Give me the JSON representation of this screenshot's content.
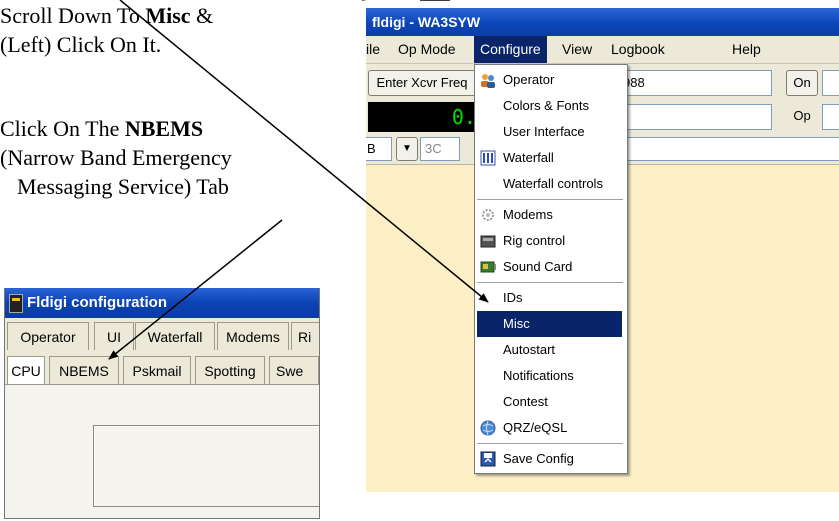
{
  "instructions": {
    "step1_line1_pre": "Scroll Down To ",
    "step1_bold": "Misc",
    "step1_line1_post": " &",
    "step1_line2": "(Left) Click On It.",
    "step2_line1_pre": "Click On The ",
    "step2_bold": "NBEMS",
    "step2_line2": "(Narrow Band Emergency",
    "step2_line3": "Messaging Service) Tab"
  },
  "config_window": {
    "title": "Fldigi configuration",
    "tabs_row1": [
      "Operator",
      "UI",
      "Waterfall",
      "Modems",
      "Ri"
    ],
    "tabs_row2": [
      "CPU",
      "NBEMS",
      "Pskmail",
      "Spotting",
      "Swe"
    ],
    "selected_tab": "CPU"
  },
  "main_window": {
    "title": "fldigi - WA3SYW",
    "menus": [
      "ile",
      "Op Mode",
      "Configure",
      "View",
      "Logbook",
      "Help"
    ],
    "open_menu": "Configure",
    "freq_label": "Enter Xcvr Freq",
    "freq_display": "0.",
    "freq_partial": "988",
    "on_button": "On",
    "op_label": "Op",
    "mode_partial": "B",
    "bw_partial": "3C",
    "dropdown_arrow": "▼"
  },
  "configure_menu": {
    "items": [
      {
        "label": "Operator",
        "icon": "operator-icon"
      },
      {
        "label": "Colors & Fonts",
        "icon": ""
      },
      {
        "label": "User Interface",
        "icon": ""
      },
      {
        "label": "Waterfall",
        "icon": "waterfall-icon"
      },
      {
        "label": "Waterfall controls",
        "icon": ""
      },
      {
        "label": "Modems",
        "icon": "modems-icon"
      },
      {
        "label": "Rig control",
        "icon": "rig-control-icon"
      },
      {
        "label": "Sound Card",
        "icon": "sound-card-icon"
      },
      {
        "label": "IDs",
        "icon": ""
      },
      {
        "label": "Misc",
        "icon": ""
      },
      {
        "label": "Autostart",
        "icon": ""
      },
      {
        "label": "Notifications",
        "icon": ""
      },
      {
        "label": "Contest",
        "icon": ""
      },
      {
        "label": "QRZ/eQSL",
        "icon": "globe-icon"
      },
      {
        "label": "Save Config",
        "icon": "save-icon"
      }
    ],
    "highlighted": "Misc"
  },
  "colors": {
    "title_blue": "#0a43b3",
    "highlight": "#0a246a",
    "freq_green": "#00e000",
    "workspace": "#fcefc6"
  }
}
